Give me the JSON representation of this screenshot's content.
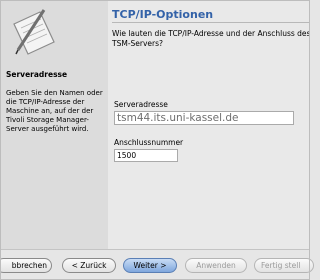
{
  "sidebar": {
    "logo_icon": "document-pen-icon",
    "section_title": "Serveradresse",
    "help_text": "Geben Sie den Namen oder die TCP/IP-Adresse der Maschine an, auf der der Tivoli Storage Manager-Server ausgeführt wird."
  },
  "main": {
    "title": "TCP/IP-Optionen",
    "question": "Wie lauten die TCP/IP-Adresse und der Anschluss des TSM-Servers?",
    "server_label": "Serveradresse",
    "server_value": "tsm44.its.uni-kassel.de",
    "port_label": "Anschlussnummer",
    "port_value": "1500"
  },
  "buttons": {
    "cancel": "bbrechen",
    "back": "< Zurück",
    "next": "Weiter >",
    "apply": "Anwenden",
    "finish": "Fertig stell"
  },
  "colors": {
    "title": "#3362a8",
    "primary_button": "#7fa7dd"
  }
}
